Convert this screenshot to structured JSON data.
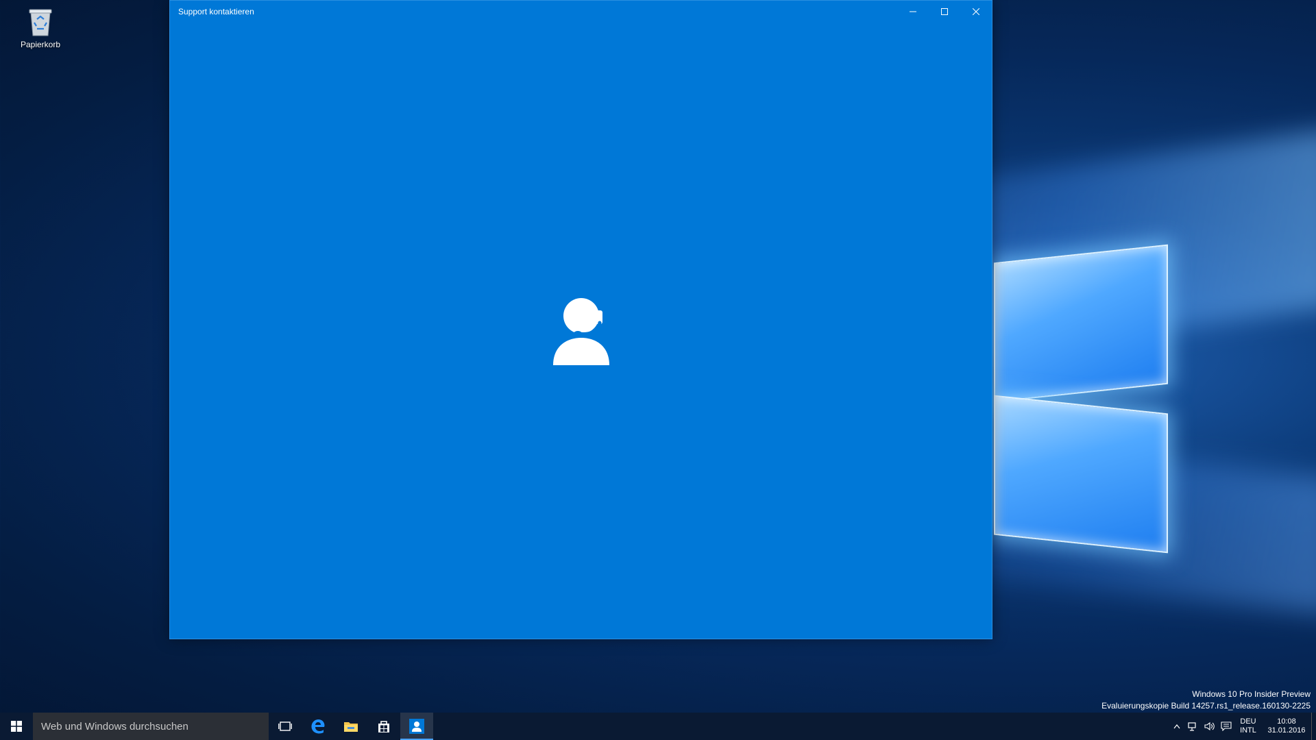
{
  "desktop": {
    "icons": [
      {
        "label": "Papierkorb",
        "icon": "recycle-bin-icon"
      }
    ]
  },
  "window": {
    "title": "Support kontaktieren",
    "controls": {
      "minimize": "minimize-icon",
      "maximize": "maximize-icon",
      "close": "close-icon"
    },
    "content_icon": "support-agent-headset-icon",
    "background_color": "#0078d7"
  },
  "watermark": {
    "line1": "Windows 10 Pro Insider Preview",
    "line2": "Evaluierungskopie Build 14257.rs1_release.160130-2225"
  },
  "taskbar": {
    "search_placeholder": "Web und Windows durchsuchen",
    "pinned": [
      {
        "name": "task-view",
        "icon": "task-view-icon"
      },
      {
        "name": "edge",
        "icon": "edge-icon"
      },
      {
        "name": "file-explorer",
        "icon": "folder-icon"
      },
      {
        "name": "store",
        "icon": "store-icon"
      },
      {
        "name": "support",
        "icon": "support-icon",
        "active": true
      }
    ],
    "tray": {
      "lang_top": "DEU",
      "lang_bottom": "INTL",
      "time": "10:08",
      "date": "31.01.2016"
    },
    "accent_color": "#4aa3ff"
  }
}
